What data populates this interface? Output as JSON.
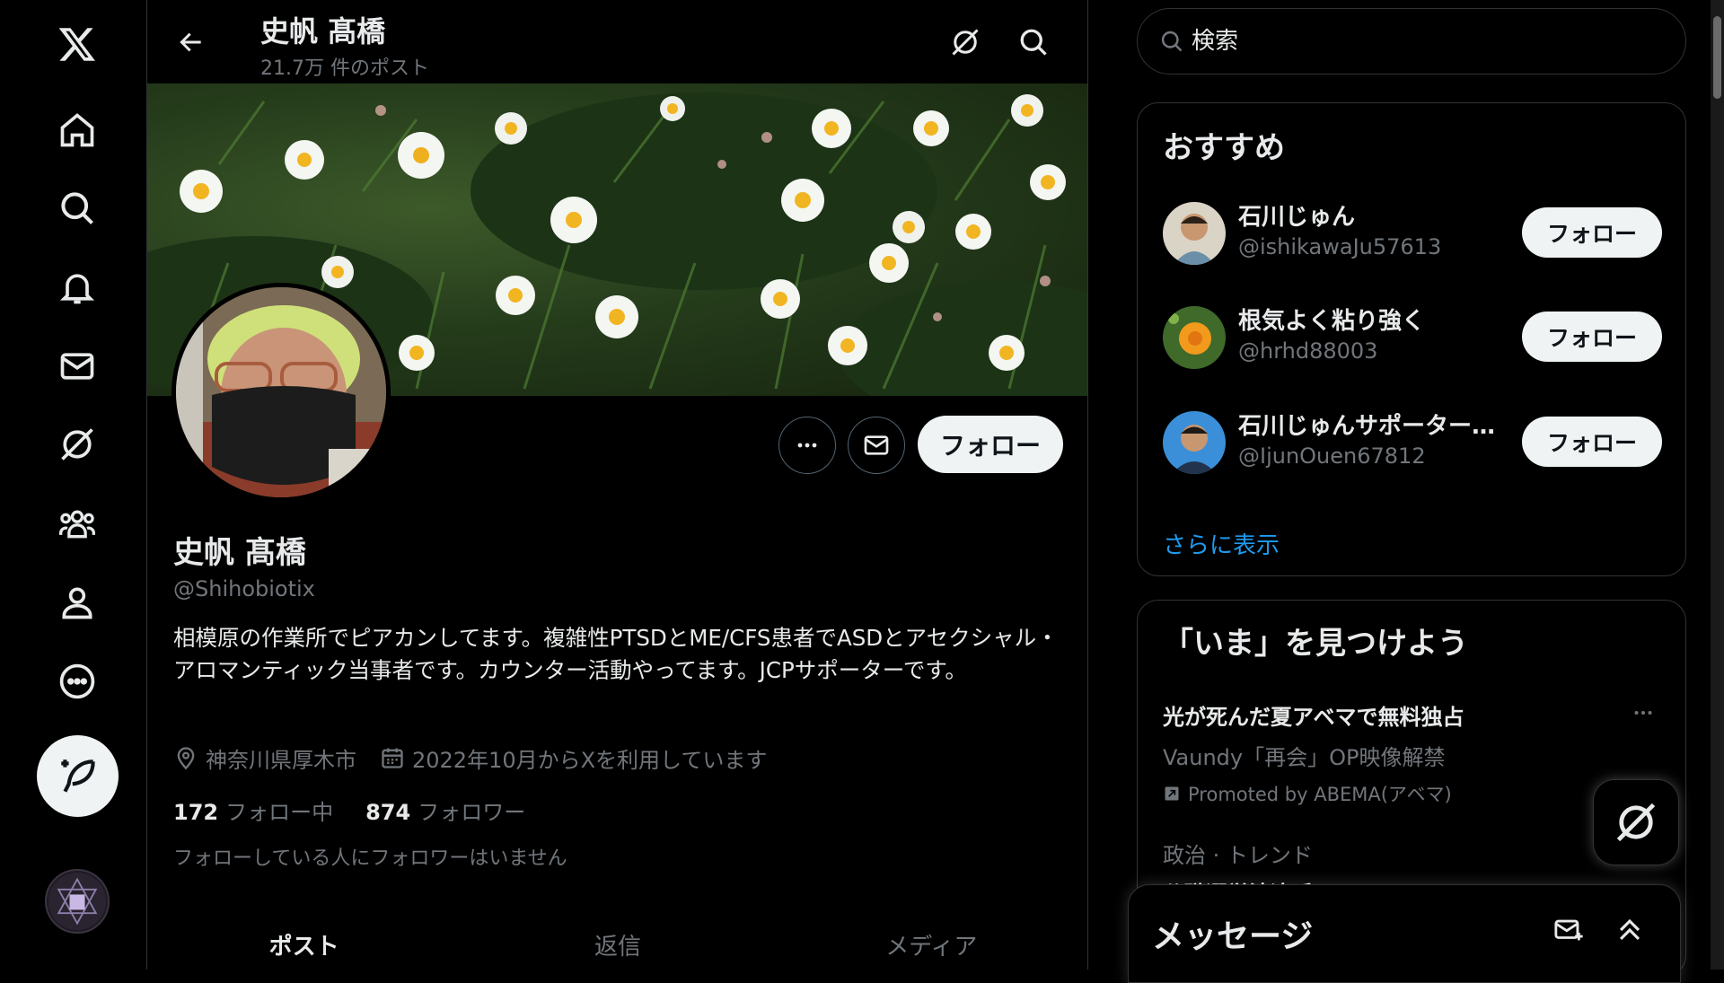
{
  "header": {
    "name": "史帆 髙橋",
    "post_count": "21.7万 件のポスト"
  },
  "profile": {
    "name": "史帆 髙橋",
    "handle": "@Shihobiotix",
    "bio": "相模原の作業所でピアカンしてます。複雑性PTSDとME/CFS患者でASDとアセクシャル・アロマンティック当事者です。カウンター活動やってます。JCPサポーターです。",
    "location": "神奈川県厚木市",
    "joined": "2022年10月からXを利用しています",
    "following_count": "172",
    "following_label": "フォロー中",
    "followers_count": "874",
    "followers_label": "フォロワー",
    "followers_note": "フォローしている人にフォロワーはいません",
    "follow_label": "フォロー"
  },
  "tabs": [
    {
      "label": "ポスト"
    },
    {
      "label": "返信"
    },
    {
      "label": "メディア"
    }
  ],
  "search": {
    "placeholder": "検索"
  },
  "recommend": {
    "title": "おすすめ",
    "items": [
      {
        "name": "石川じゅん",
        "handle": "@ishikawaJu57613",
        "button": "フォロー"
      },
      {
        "name": "根気よく粘り強く",
        "handle": "@hrhd88003",
        "button": "フォロー"
      },
      {
        "name": "石川じゅんサポーター…",
        "handle": "@IjunOuen67812",
        "button": "フォロー"
      }
    ],
    "show_more": "さらに表示"
  },
  "explore": {
    "title": "「いま」を見つけよう",
    "trends": [
      {
        "title": "光が死んだ夏アベマで無料独占",
        "sub": "Vaundy「再会」OP映像解禁",
        "promo": "Promoted by ABEMA(アベマ)"
      },
      {
        "category": "政治 · トレンド",
        "title": "公職選挙法違反"
      }
    ]
  },
  "messages": {
    "title": "メッセージ"
  },
  "colors": {
    "background": "#000000",
    "text": "#e7e9ea",
    "muted": "#71767b",
    "accent": "#1d9bf0",
    "button_bg": "#eff3f4"
  },
  "icons": [
    "x-logo-icon",
    "home-icon",
    "search-icon",
    "bell-icon",
    "mail-icon",
    "grok-icon",
    "communities-icon",
    "profile-icon",
    "more-icon",
    "compose-icon",
    "back-arrow-icon",
    "ellipsis-icon",
    "location-icon",
    "calendar-icon",
    "new-message-icon",
    "chevron-up-icon"
  ]
}
